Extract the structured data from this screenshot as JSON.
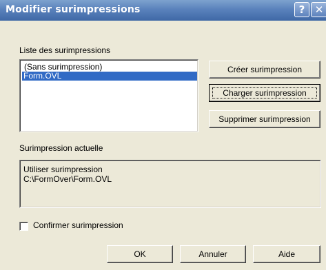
{
  "window": {
    "title": "Modifier surimpressions",
    "help_glyph": "?",
    "close_glyph": "✕"
  },
  "overlay_list": {
    "label": "Liste des surimpressions",
    "items": [
      {
        "label": "(Sans surimpression)",
        "selected": false
      },
      {
        "label": "Form.OVL",
        "selected": true
      }
    ]
  },
  "actions": {
    "create": "Créer surimpression",
    "load": "Charger surimpression",
    "delete": "Supprimer surimpression"
  },
  "current_overlay": {
    "label": "Surimpression actuelle",
    "line1": "Utiliser surimpression",
    "line2": "C:\\FormOver\\Form.OVL"
  },
  "confirm": {
    "label": "Confirmer surimpression",
    "checked": false
  },
  "footer": {
    "ok": "OK",
    "cancel": "Annuler",
    "help": "Aide"
  },
  "colors": {
    "selection": "#316ac5",
    "title_bar": "#5a82bc",
    "dialog_bg": "#ece9d8"
  }
}
